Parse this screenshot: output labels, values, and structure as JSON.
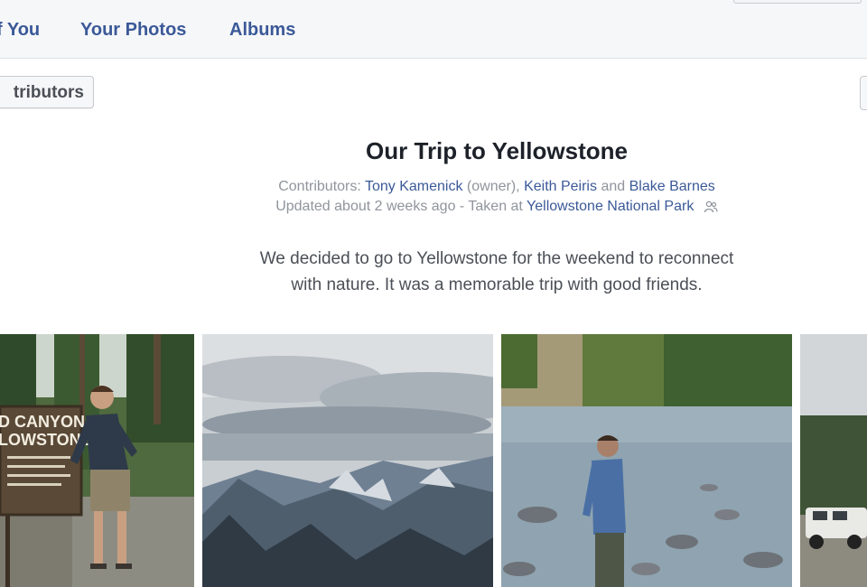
{
  "nav": {
    "tabs": [
      {
        "label": "f You"
      },
      {
        "label": "Your Photos"
      },
      {
        "label": "Albums"
      }
    ]
  },
  "toolbar": {
    "contributors_button_label": "tributors"
  },
  "album": {
    "title": "Our Trip to Yellowstone",
    "contributors_prefix": "Contributors:",
    "owner_name": "Tony Kamenick",
    "owner_tag": "(owner),",
    "contributor_2": "Keith Peiris",
    "and_word": "and",
    "contributor_3": "Blake Barnes",
    "updated_text": "Updated about 2 weeks ago - Taken at",
    "location": "Yellowstone National Park",
    "description_line1": "We decided to go to Yellowstone for the weekend to reconnect",
    "description_line2": "with nature. It was a memorable trip with good friends.",
    "sign_text_line1": "D CANYON",
    "sign_text_line2": "LOWSTONE"
  },
  "colors": {
    "link": "#3b5998",
    "secondary_text": "#90949c",
    "title_text": "#1d2129"
  }
}
